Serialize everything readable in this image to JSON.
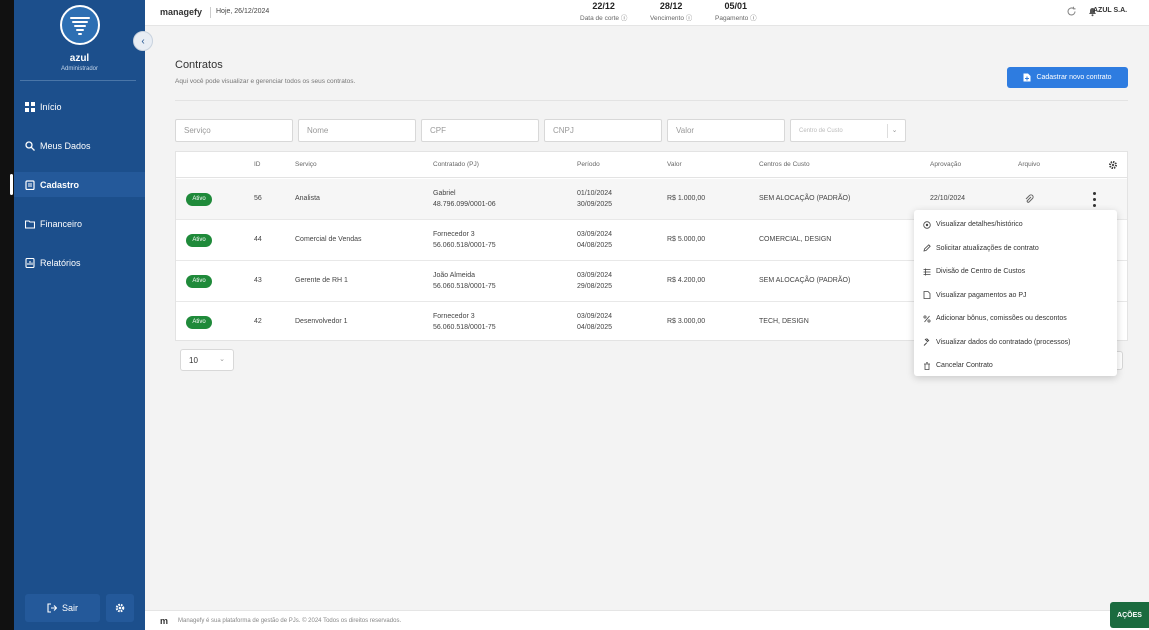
{
  "user": {
    "name": "azul",
    "role": "Administrador"
  },
  "sidebar": {
    "items": [
      {
        "label": "Início"
      },
      {
        "label": "Meus Dados"
      },
      {
        "label": "Cadastro"
      },
      {
        "label": "Financeiro"
      },
      {
        "label": "Relatórios"
      }
    ],
    "logout_label": "Sair"
  },
  "topbar": {
    "brand": "managefy",
    "today": "Hoje, 26/12/2024",
    "stats": [
      {
        "date": "22/12",
        "label": "Data de corte"
      },
      {
        "date": "28/12",
        "label": "Vencimento"
      },
      {
        "date": "05/01",
        "label": "Pagamento"
      }
    ],
    "company": "AZUL S.A."
  },
  "page": {
    "title": "Contratos",
    "subtitle": "Aqui você pode visualizar e gerenciar todos os seus contratos.",
    "new_button": "Cadastrar novo contrato"
  },
  "filters": {
    "servico": "Serviço",
    "nome": "Nome",
    "cpf": "CPF",
    "cnpj": "CNPJ",
    "valor": "Valor",
    "centro": "Centro de Custo"
  },
  "table": {
    "headers": {
      "id": "ID",
      "servico": "Serviço",
      "contratado": "Contratado (PJ)",
      "periodo": "Período",
      "valor": "Valor",
      "centros": "Centros de Custo",
      "aprovacao": "Aprovação",
      "arquivo": "Arquivo"
    },
    "rows": [
      {
        "status": "Ativo",
        "id": "56",
        "servico": "Analista",
        "nome": "Gabriel",
        "doc": "48.796.099/0001-06",
        "inicio": "01/10/2024",
        "fim": "30/09/2025",
        "valor": "R$ 1.000,00",
        "centro": "SEM ALOCAÇÃO (PADRÃO)",
        "aprovacao": "22/10/2024"
      },
      {
        "status": "Ativo",
        "id": "44",
        "servico": "Comercial de Vendas",
        "nome": "Fornecedor 3",
        "doc": "56.060.518/0001-75",
        "inicio": "03/09/2024",
        "fim": "04/08/2025",
        "valor": "R$ 5.000,00",
        "centro": "COMERCIAL, DESIGN",
        "aprovacao": ""
      },
      {
        "status": "Ativo",
        "id": "43",
        "servico": "Gerente de RH 1",
        "nome": "João Almeida",
        "doc": "56.060.518/0001-75",
        "inicio": "03/09/2024",
        "fim": "29/08/2025",
        "valor": "R$ 4.200,00",
        "centro": "SEM ALOCAÇÃO (PADRÃO)",
        "aprovacao": ""
      },
      {
        "status": "Ativo",
        "id": "42",
        "servico": "Desenvolvedor 1",
        "nome": "Fornecedor 3",
        "doc": "56.060.518/0001-75",
        "inicio": "03/09/2024",
        "fim": "04/08/2025",
        "valor": "R$ 3.000,00",
        "centro": "TECH, DESIGN",
        "aprovacao": ""
      }
    ],
    "per_page": "10"
  },
  "menu": {
    "items": [
      {
        "label": "Visualizar detalhes/histórico",
        "icon": "eye-icon"
      },
      {
        "label": "Solicitar atualizações de contrato",
        "icon": "pencil-icon"
      },
      {
        "label": "Divisão de Centro de Custos",
        "icon": "grid-icon"
      },
      {
        "label": "Visualizar pagamentos ao PJ",
        "icon": "document-icon"
      },
      {
        "label": "Adicionar bônus, comissões ou descontos",
        "icon": "percent-icon"
      },
      {
        "label": "Visualizar dados do contratado (processos)",
        "icon": "gavel-icon"
      },
      {
        "label": "Cancelar Contrato",
        "icon": "trash-icon"
      }
    ]
  },
  "footer": {
    "mark": "m",
    "text": "Managefy é sua plataforma de gestão de PJs. © 2024 Todos os direitos reservados."
  },
  "actions_label": "AÇÕES",
  "colors": {
    "sidebar": "#1c4f8c",
    "primary_button": "#2e7ce0",
    "status_active": "#1f8a3a",
    "actions": "#1a6b3f"
  }
}
